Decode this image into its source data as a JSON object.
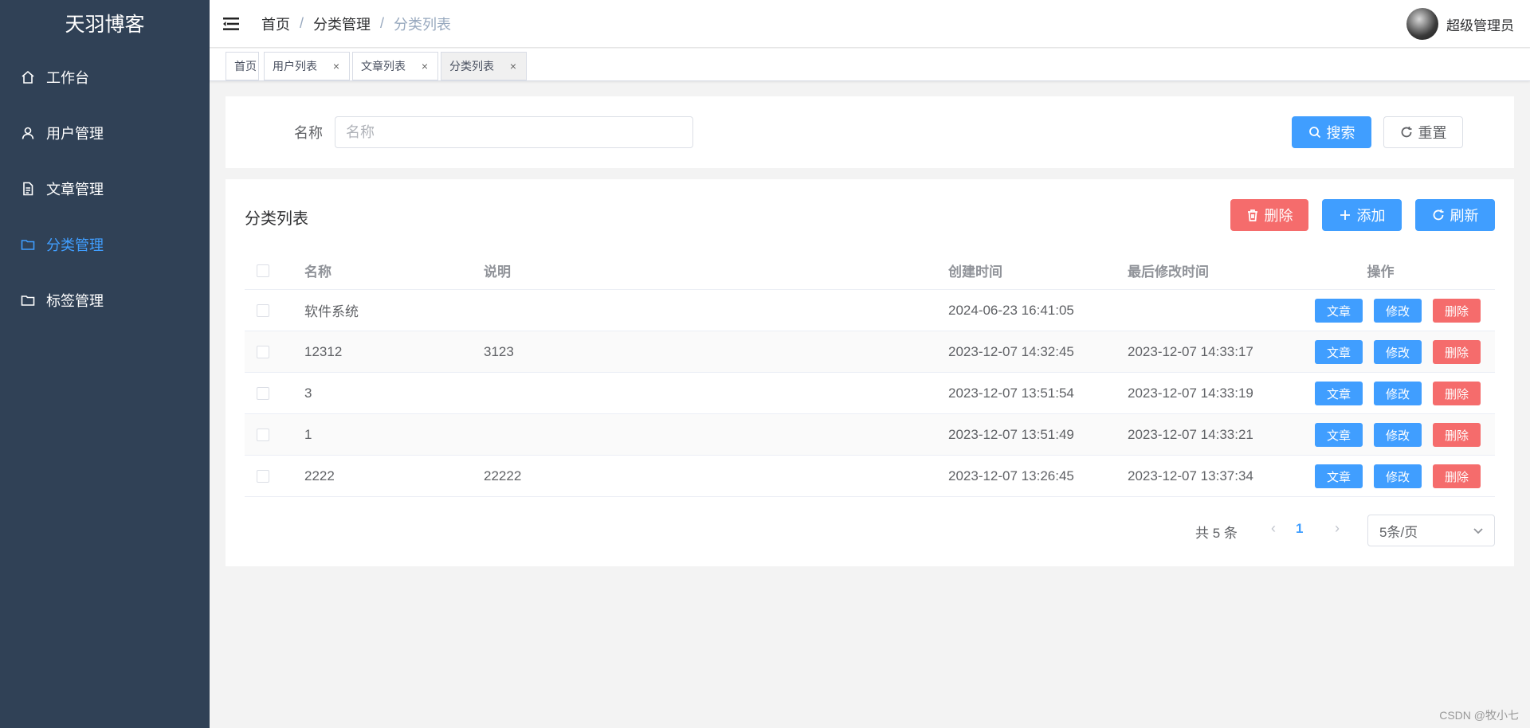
{
  "app": {
    "title": "天羽博客"
  },
  "sidebar": {
    "items": [
      {
        "label": "工作台",
        "icon": "home-icon"
      },
      {
        "label": "用户管理",
        "icon": "user-icon"
      },
      {
        "label": "文章管理",
        "icon": "document-icon"
      },
      {
        "label": "分类管理",
        "icon": "folder-icon",
        "active": true
      },
      {
        "label": "标签管理",
        "icon": "folder-icon"
      }
    ]
  },
  "header": {
    "breadcrumb": [
      "首页",
      "分类管理",
      "分类列表"
    ],
    "separator": "/",
    "user_name": "超级管理员"
  },
  "tabs": [
    {
      "label": "首页"
    },
    {
      "label": "用户列表",
      "close": "×"
    },
    {
      "label": "文章列表",
      "close": "×"
    },
    {
      "label": "分类列表",
      "close": "×",
      "active": true
    }
  ],
  "search": {
    "label": "名称",
    "placeholder": "名称",
    "value": "",
    "search_button": "搜索",
    "reset_button": "重置"
  },
  "table_section": {
    "title": "分类列表",
    "delete_button": "删除",
    "add_button": "添加",
    "refresh_button": "刷新",
    "columns": [
      "名称",
      "说明",
      "创建时间",
      "最后修改时间",
      "操作"
    ],
    "rows": [
      {
        "name": "软件系统",
        "desc": "",
        "created": "2024-06-23 16:41:05",
        "modified": ""
      },
      {
        "name": "12312",
        "desc": "3123",
        "created": "2023-12-07 14:32:45",
        "modified": "2023-12-07 14:33:17"
      },
      {
        "name": "3",
        "desc": "",
        "created": "2023-12-07 13:51:54",
        "modified": "2023-12-07 14:33:19"
      },
      {
        "name": "1",
        "desc": "",
        "created": "2023-12-07 13:51:49",
        "modified": "2023-12-07 14:33:21"
      },
      {
        "name": "2222",
        "desc": "22222",
        "created": "2023-12-07 13:26:45",
        "modified": "2023-12-07 13:37:34"
      }
    ],
    "row_actions": {
      "article": "文章",
      "edit": "修改",
      "delete": "删除"
    }
  },
  "pagination": {
    "total_text": "共 5 条",
    "prev": "‹",
    "current_page": "1",
    "next": "›",
    "page_size": "5条/页"
  },
  "watermark": "CSDN @牧小七",
  "colors": {
    "sidebar_bg": "#304156",
    "primary": "#409eff",
    "danger": "#f56c6c"
  }
}
